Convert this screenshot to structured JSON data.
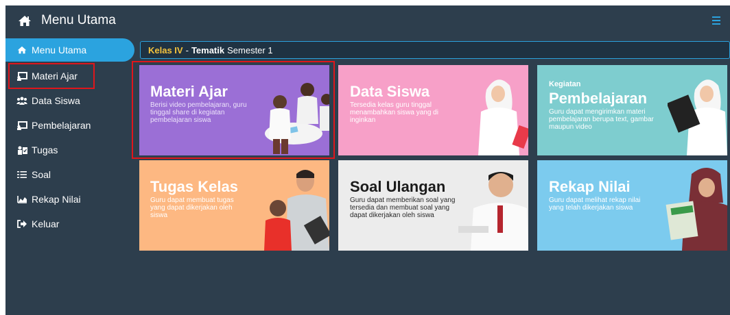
{
  "header": {
    "title": "Menu Utama"
  },
  "sidebar": {
    "items": [
      {
        "label": "Menu Utama",
        "icon": "home-icon"
      },
      {
        "label": "Materi Ajar",
        "icon": "chalkboard-icon"
      },
      {
        "label": "Data Siswa",
        "icon": "users-icon"
      },
      {
        "label": "Pembelajaran",
        "icon": "chalkboard-icon"
      },
      {
        "label": "Tugas",
        "icon": "tasks-icon"
      },
      {
        "label": "Soal",
        "icon": "list-icon"
      },
      {
        "label": "Rekap Nilai",
        "icon": "chart-area-icon"
      },
      {
        "label": "Keluar",
        "icon": "sign-out-icon"
      }
    ]
  },
  "breadcrumb": {
    "kelas": "Kelas IV",
    "separator": "-",
    "tema": "Tematik",
    "semester": "Semester 1"
  },
  "cards": [
    {
      "title": "Materi Ajar",
      "desc": "Berisi video pembelajaran, guru tinggal share di kegiatan pembelajaran siswa",
      "color": "#9b6fd6"
    },
    {
      "title": "Data Siswa",
      "desc": "Tersedia kelas guru tinggal menambahkan siswa yang di inginkan",
      "color": "#f7a0c8"
    },
    {
      "pre": "Kegiatan",
      "title": "Pembelajaran",
      "desc": "Guru dapat mengirimkan materi pembelajaran berupa text, gambar maupun video",
      "color": "#7ecdcf"
    },
    {
      "title": "Tugas Kelas",
      "desc": "Guru dapat membuat tugas yang dapat dikerjakan oleh siswa",
      "color": "#fdb882"
    },
    {
      "title": "Soal Ulangan",
      "desc": "Guru dapat memberikan soal yang tersedia dan membuat soal yang dapat dikerjakan oleh siswa",
      "color": "#ececec"
    },
    {
      "title": "Rekap Nilai",
      "desc": "Guru dapat melihat rekap nilai yang telah dikerjakan siswa",
      "color": "#7ccbee"
    }
  ],
  "colors": {
    "dark": "#2d3e4d",
    "accent": "#2ba3df",
    "highlight": "#e0161b",
    "kelas": "#f4c33d"
  }
}
